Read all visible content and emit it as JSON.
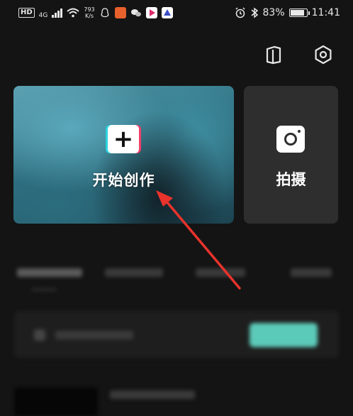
{
  "status_bar": {
    "hd": "HD",
    "network": "4G",
    "speed_value": "793",
    "speed_unit": "K/s",
    "battery": "83%",
    "time": "11:41"
  },
  "main": {
    "create_label": "开始创作",
    "shoot_label": "拍摄"
  },
  "colors": {
    "background": "#141414",
    "card_dark": "#2e2e2e",
    "accent_teal": "#5ccab8",
    "annotation_red": "#e8332c"
  },
  "icons": {
    "tutorial": "book-icon",
    "settings": "hexagon-gear-icon",
    "create": "plus-icon",
    "shoot": "camera-icon"
  }
}
